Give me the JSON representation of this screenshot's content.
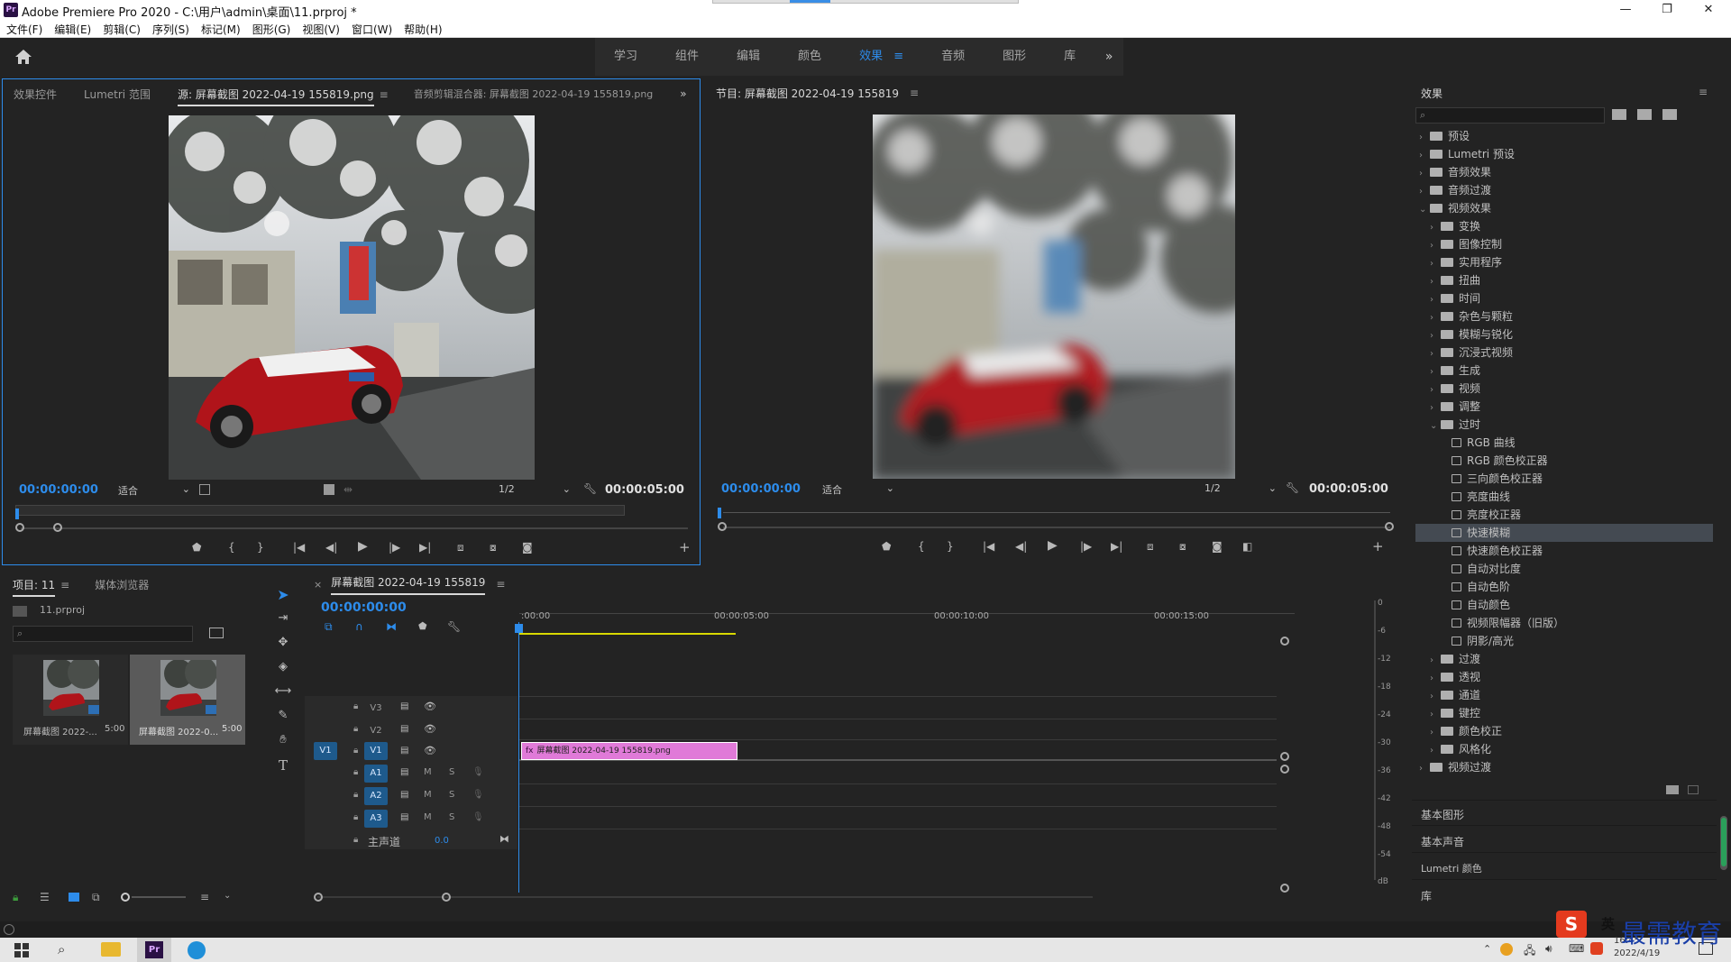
{
  "window": {
    "title": "Adobe Premiere Pro 2020 - C:\\用户\\admin\\桌面\\11.prproj *",
    "app_icon": "Pr",
    "minimize": "—",
    "maximize": "❐",
    "close": "✕"
  },
  "menu": [
    "文件(F)",
    "编辑(E)",
    "剪辑(C)",
    "序列(S)",
    "标记(M)",
    "图形(G)",
    "视图(V)",
    "窗口(W)",
    "帮助(H)"
  ],
  "workspaces": {
    "tabs": [
      "学习",
      "组件",
      "编辑",
      "颜色",
      "效果",
      "音频",
      "图形",
      "库"
    ],
    "active": "效果",
    "active_menu": "≡",
    "more": "»"
  },
  "source_panel": {
    "tabs": [
      "效果控件",
      "Lumetri 范围",
      "源: 屏幕截图 2022-04-19 155819.png",
      "音频剪辑混合器: 屏幕截图 2022-04-19 155819.png"
    ],
    "active_tab_menu": "≡",
    "overflow": "»",
    "timecode": "00:00:00:00",
    "fit": "适合",
    "resolution": "1/2",
    "duration": "00:00:05:00"
  },
  "program_panel": {
    "title": "节目: 屏幕截图 2022-04-19 155819",
    "title_menu": "≡",
    "timecode": "00:00:00:00",
    "fit": "适合",
    "resolution": "1/2",
    "duration": "00:00:05:00"
  },
  "project_panel": {
    "tabs": [
      "项目: 11",
      "媒体浏览器"
    ],
    "tab_menu": "≡",
    "project_file": "11.prproj",
    "items": [
      {
        "name": "屏幕截图 2022-...",
        "duration": "5:00"
      },
      {
        "name": "屏幕截图 2022-0...",
        "duration": "5:00"
      }
    ]
  },
  "timeline": {
    "tab": "屏幕截图 2022-04-19 155819",
    "close": "×",
    "tab_menu": "≡",
    "timecode": "00:00:00:00",
    "ruler": [
      ":00:00",
      "00:00:05:00",
      "00:00:10:00",
      "00:00:15:00"
    ],
    "video_tracks": [
      "V3",
      "V2",
      "V1"
    ],
    "audio_tracks": [
      "A1",
      "A2",
      "A3"
    ],
    "source_patch": "V1",
    "mute": "M",
    "solo": "S",
    "master_label": "主声道",
    "master_value": "0.0",
    "clip_label": "屏幕截图 2022-04-19 155819.png",
    "clip_fx": "fx"
  },
  "meter": {
    "labels": [
      "0",
      "-6",
      "-12",
      "-18",
      "-24",
      "-30",
      "-36",
      "-42",
      "-48",
      "-54",
      "dB"
    ]
  },
  "effects_panel": {
    "title": "效果",
    "title_menu": "≡",
    "tree": [
      {
        "label": "预设",
        "level": 0,
        "type": "folder",
        "open": false
      },
      {
        "label": "Lumetri 预设",
        "level": 0,
        "type": "folder",
        "open": false
      },
      {
        "label": "音频效果",
        "level": 0,
        "type": "folder",
        "open": false
      },
      {
        "label": "音频过渡",
        "level": 0,
        "type": "folder",
        "open": false
      },
      {
        "label": "视频效果",
        "level": 0,
        "type": "folder",
        "open": true
      },
      {
        "label": "变换",
        "level": 1,
        "type": "folder",
        "open": false
      },
      {
        "label": "图像控制",
        "level": 1,
        "type": "folder",
        "open": false
      },
      {
        "label": "实用程序",
        "level": 1,
        "type": "folder",
        "open": false
      },
      {
        "label": "扭曲",
        "level": 1,
        "type": "folder",
        "open": false
      },
      {
        "label": "时间",
        "level": 1,
        "type": "folder",
        "open": false
      },
      {
        "label": "杂色与颗粒",
        "level": 1,
        "type": "folder",
        "open": false
      },
      {
        "label": "模糊与锐化",
        "level": 1,
        "type": "folder",
        "open": false
      },
      {
        "label": "沉浸式视频",
        "level": 1,
        "type": "folder",
        "open": false
      },
      {
        "label": "生成",
        "level": 1,
        "type": "folder",
        "open": false
      },
      {
        "label": "视频",
        "level": 1,
        "type": "folder",
        "open": false
      },
      {
        "label": "调整",
        "level": 1,
        "type": "folder",
        "open": false
      },
      {
        "label": "过时",
        "level": 1,
        "type": "folder",
        "open": true
      },
      {
        "label": "RGB 曲线",
        "level": 2,
        "type": "fx"
      },
      {
        "label": "RGB 颜色校正器",
        "level": 2,
        "type": "fx"
      },
      {
        "label": "三向颜色校正器",
        "level": 2,
        "type": "fx"
      },
      {
        "label": "亮度曲线",
        "level": 2,
        "type": "fx"
      },
      {
        "label": "亮度校正器",
        "level": 2,
        "type": "fx"
      },
      {
        "label": "快速模糊",
        "level": 2,
        "type": "fx",
        "selected": true
      },
      {
        "label": "快速颜色校正器",
        "level": 2,
        "type": "fx"
      },
      {
        "label": "自动对比度",
        "level": 2,
        "type": "fx"
      },
      {
        "label": "自动色阶",
        "level": 2,
        "type": "fx"
      },
      {
        "label": "自动颜色",
        "level": 2,
        "type": "fx"
      },
      {
        "label": "视频限幅器（旧版）",
        "level": 2,
        "type": "fx"
      },
      {
        "label": "阴影/高光",
        "level": 2,
        "type": "fx"
      },
      {
        "label": "过渡",
        "level": 1,
        "type": "folder",
        "open": false
      },
      {
        "label": "透视",
        "level": 1,
        "type": "folder",
        "open": false
      },
      {
        "label": "通道",
        "level": 1,
        "type": "folder",
        "open": false
      },
      {
        "label": "键控",
        "level": 1,
        "type": "folder",
        "open": false
      },
      {
        "label": "颜色校正",
        "level": 1,
        "type": "folder",
        "open": false
      },
      {
        "label": "风格化",
        "level": 1,
        "type": "folder",
        "open": false
      },
      {
        "label": "视频过渡",
        "level": 0,
        "type": "folder",
        "open": false
      }
    ],
    "collapsed_panels": [
      "基本图形",
      "基本声音",
      "Lumetri 颜色",
      "库"
    ]
  },
  "watermark": "最需教育",
  "ime": {
    "logo": "S",
    "lang": "英"
  },
  "taskbar": {
    "clock": "16:45",
    "date": "2022/4/19"
  },
  "colors": {
    "accent": "#2d8ceb",
    "clip": "#e07ad8",
    "playhead": "#2d8ceb",
    "work_area": "#d8d800"
  }
}
